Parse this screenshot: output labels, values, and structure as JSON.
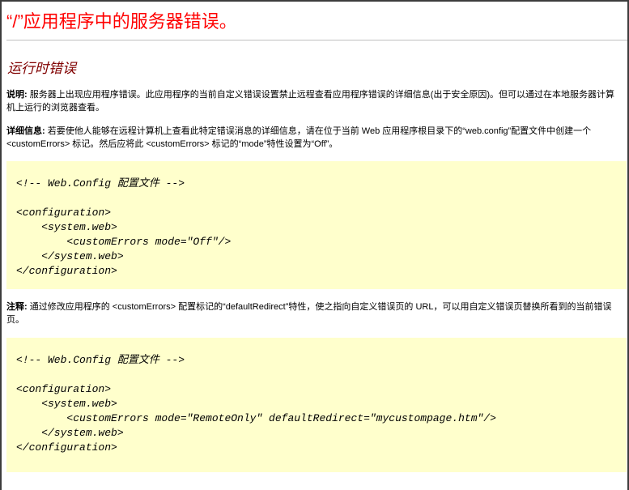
{
  "page": {
    "title": "“/”应用程序中的服务器错误。",
    "subtitle": "运行时错误"
  },
  "description": {
    "label": "说明:",
    "text": " 服务器上出现应用程序错误。此应用程序的当前自定义错误设置禁止远程查看应用程序错误的详细信息(出于安全原因)。但可以通过在本地服务器计算机上运行的浏览器查看。"
  },
  "details": {
    "label": "详细信息:",
    "text": " 若要使他人能够在远程计算机上查看此特定错误消息的详细信息，请在位于当前 Web 应用程序根目录下的“web.config”配置文件中创建一个 <customErrors> 标记。然后应将此 <customErrors> 标记的“mode”特性设置为“Off”。"
  },
  "code1": {
    "lines": [
      "<!-- Web.Config 配置文件 -->",
      "",
      "<configuration>",
      "    <system.web>",
      "        <customErrors mode=\"Off\"/>",
      "    </system.web>",
      "</configuration>"
    ]
  },
  "notes": {
    "label": "注释:",
    "text": " 通过修改应用程序的 <customErrors> 配置标记的“defaultRedirect”特性，使之指向自定义错误页的 URL，可以用自定义错误页替换所看到的当前错误页。"
  },
  "code2": {
    "lines": [
      "<!-- Web.Config 配置文件 -->",
      "",
      "<configuration>",
      "    <system.web>",
      "        <customErrors mode=\"RemoteOnly\" defaultRedirect=\"mycustompage.htm\"/>",
      "    </system.web>",
      "</configuration>"
    ]
  }
}
